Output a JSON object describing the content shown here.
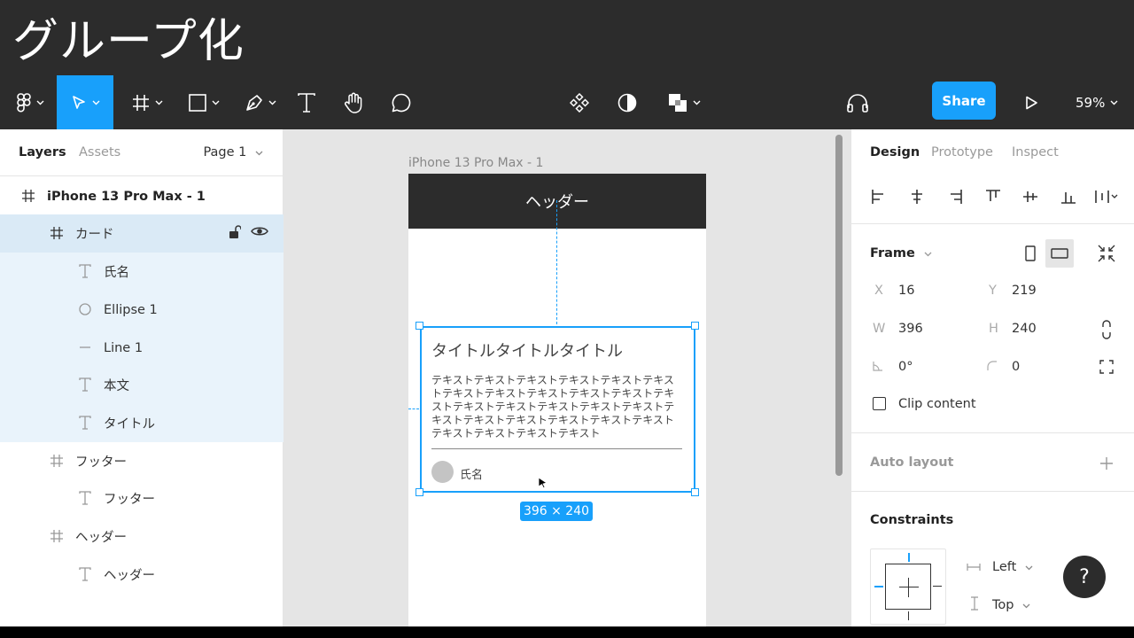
{
  "page_title": "グループ化",
  "toolbar": {
    "share_label": "Share",
    "zoom": "59%",
    "tools": [
      "figma-menu",
      "move-tool",
      "frame-tool",
      "shape-tool",
      "pen-tool",
      "text-tool",
      "hand-tool",
      "comment-tool",
      "component-tool",
      "mask-tool",
      "boolean-tool",
      "audio-tool",
      "present-tool"
    ]
  },
  "left_panel": {
    "tab_layers": "Layers",
    "tab_assets": "Assets",
    "page": "Page 1",
    "layers": [
      {
        "label": "iPhone 13 Pro Max - 1",
        "icon": "frame-icon"
      },
      {
        "label": "カード",
        "icon": "frame-icon"
      },
      {
        "label": "氏名",
        "icon": "text-icon"
      },
      {
        "label": "Ellipse 1",
        "icon": "ellipse-icon"
      },
      {
        "label": "Line 1",
        "icon": "line-icon"
      },
      {
        "label": "本文",
        "icon": "text-icon"
      },
      {
        "label": "タイトル",
        "icon": "text-icon"
      },
      {
        "label": "フッター",
        "icon": "frame-icon"
      },
      {
        "label": "フッター",
        "icon": "text-icon"
      },
      {
        "label": "ヘッダー",
        "icon": "frame-icon"
      },
      {
        "label": "ヘッダー",
        "icon": "text-icon"
      }
    ]
  },
  "canvas": {
    "frame_label": "iPhone 13 Pro Max - 1",
    "header_text": "ヘッダー",
    "card_title": "タイトルタイトルタイトル",
    "card_body": "テキストテキストテキストテキストテキストテキストテキストテキストテキストテキストテキストテキストテキストテキストテキストテキストテキストテキストテキストテキストテキストテキストテキストテキストテキストテキストテキスト",
    "card_name": "氏名",
    "size_badge": "396 × 240"
  },
  "right_panel": {
    "tab_design": "Design",
    "tab_prototype": "Prototype",
    "tab_inspect": "Inspect",
    "frame_title": "Frame",
    "x_label": "X",
    "x_value": "16",
    "y_label": "Y",
    "y_value": "219",
    "w_label": "W",
    "w_value": "396",
    "h_label": "H",
    "h_value": "240",
    "rotation": "0°",
    "radius": "0",
    "clip_content": "Clip content",
    "auto_layout": "Auto layout",
    "constraints": "Constraints",
    "constraint_h": "Left",
    "constraint_v": "Top"
  },
  "colors": {
    "accent": "#18a0fb",
    "toolbar_bg": "#2c2c2c",
    "selection_bg": "#daeaf6"
  }
}
